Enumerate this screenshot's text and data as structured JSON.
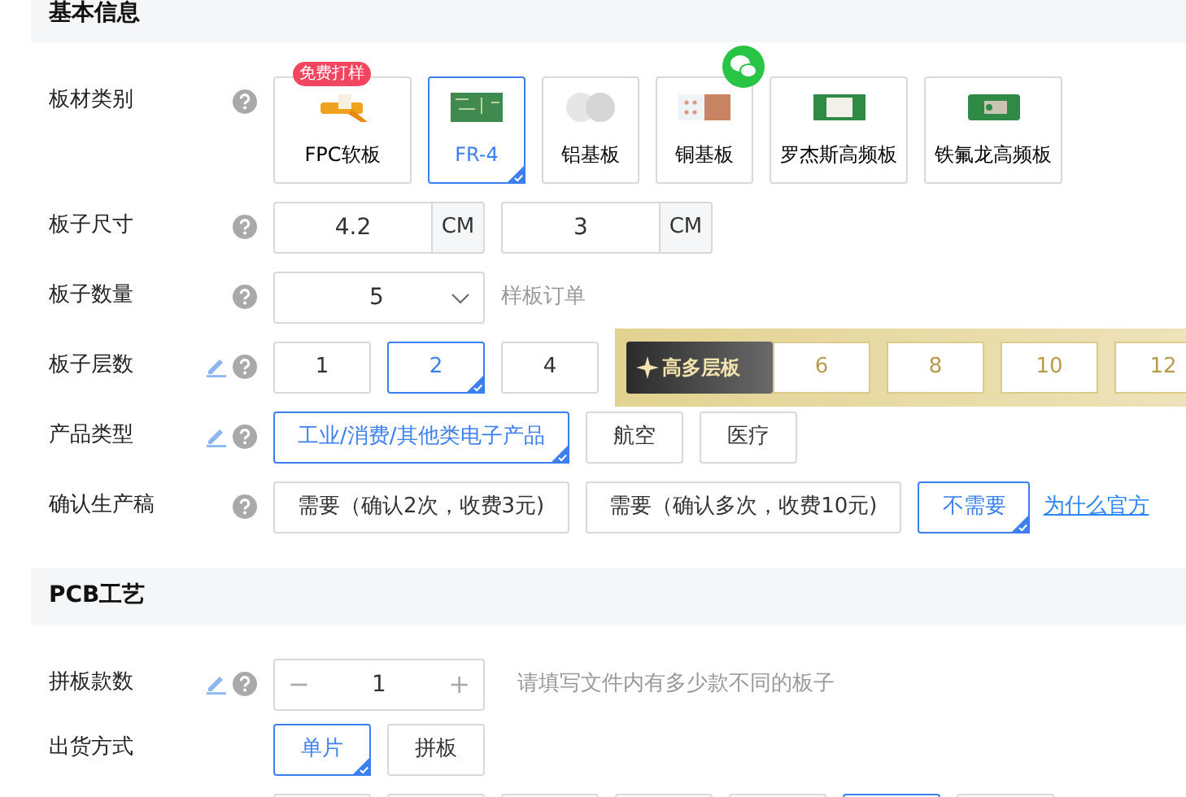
{
  "sections": [
    {
      "title": "基本信息",
      "fields": [
        {
          "label": "板材类别",
          "kind": "cards",
          "help": true,
          "editable": false,
          "options": [
            {
              "label": "FPC软板",
              "kind": "fpc",
              "badge": "免费打样",
              "wechat": false,
              "selected": false
            },
            {
              "label": "FR-4",
              "kind": "fr4",
              "wechat": false,
              "selected": true
            },
            {
              "label": "铝基板",
              "kind": "aluminum",
              "wechat": false,
              "selected": false
            },
            {
              "label": "铜基板",
              "kind": "copper",
              "wechat": true,
              "selected": false
            },
            {
              "label": "罗杰斯高频板",
              "kind": "rogers",
              "wechat": false,
              "selected": false
            },
            {
              "label": "铁氟龙高频板",
              "kind": "teflon",
              "wechat": false,
              "selected": false
            }
          ]
        },
        {
          "label": "板子尺寸",
          "kind": "dimensions",
          "help": true,
          "editable": false,
          "inputs": [
            {
              "value": "4.2",
              "unit": "CM"
            },
            {
              "value": "3",
              "unit": "CM"
            }
          ]
        },
        {
          "label": "板子数量",
          "kind": "select",
          "help": true,
          "editable": false,
          "value": "5",
          "hint": "样板订单"
        },
        {
          "label": "板子层数",
          "kind": "options",
          "help": true,
          "editable": true,
          "options": [
            {
              "label": "1",
              "selected": false
            },
            {
              "label": "2",
              "selected": true
            },
            {
              "label": "4",
              "selected": false
            }
          ],
          "premium": {
            "label": "高多层板",
            "options": [
              {
                "label": "6",
                "selected": false
              },
              {
                "label": "8",
                "selected": false
              },
              {
                "label": "10",
                "selected": false
              },
              {
                "label": "12",
                "selected": false
              }
            ]
          }
        },
        {
          "label": "产品类型",
          "kind": "options",
          "help": true,
          "editable": true,
          "options": [
            {
              "label": "工业/消费/其他类电子产品",
              "selected": true
            },
            {
              "label": "航空",
              "selected": false
            },
            {
              "label": "医疗",
              "selected": false
            }
          ]
        },
        {
          "label": "确认生产稿",
          "kind": "options",
          "help": true,
          "editable": false,
          "options": [
            {
              "label": "需要（确认2次，收费3元)",
              "selected": false
            },
            {
              "label": "需要（确认多次，收费10元)",
              "selected": false
            },
            {
              "label": "不需要",
              "selected": true
            }
          ],
          "link": "为什么官方"
        }
      ]
    },
    {
      "title": "PCB工艺",
      "fields": [
        {
          "label": "拼板款数",
          "kind": "stepper",
          "help": true,
          "editable": true,
          "minus": "−",
          "value": "1",
          "plus": "+",
          "hint": "请填写文件内有多少款不同的板子"
        },
        {
          "label": "出货方式",
          "kind": "options",
          "help": false,
          "editable": false,
          "options": [
            {
              "label": "单片",
              "selected": true
            },
            {
              "label": "拼板",
              "selected": false
            }
          ]
        },
        {
          "kind": "options",
          "help": false,
          "editable": false,
          "options": [
            {
              "selected": false
            },
            {
              "selected": false
            },
            {
              "selected": false
            },
            {
              "selected": false
            },
            {
              "selected": false
            },
            {
              "selected": true
            },
            {
              "selected": false
            }
          ]
        }
      ]
    }
  ]
}
